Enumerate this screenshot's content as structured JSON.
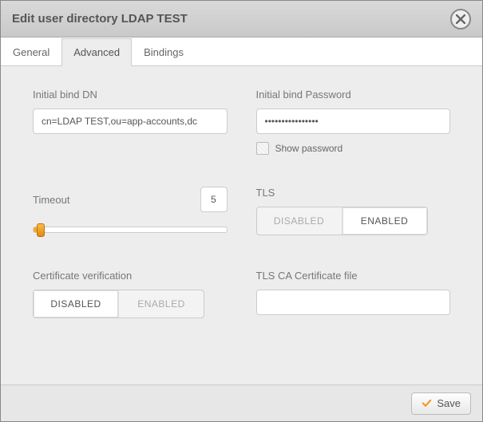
{
  "dialog": {
    "title": "Edit user directory LDAP TEST"
  },
  "tabs": {
    "general": "General",
    "advanced": "Advanced",
    "bindings": "Bindings",
    "active": "advanced"
  },
  "fields": {
    "bind_dn": {
      "label": "Initial bind DN",
      "value": "cn=LDAP TEST,ou=app-accounts,dc"
    },
    "bind_password": {
      "label": "Initial bind Password",
      "value": "••••••••••••••••",
      "show_password_label": "Show password",
      "show_password_checked": false
    },
    "timeout": {
      "label": "Timeout",
      "value": "5",
      "min": 0,
      "max": 300
    },
    "tls": {
      "label": "TLS",
      "disabled_label": "DISABLED",
      "enabled_label": "ENABLED",
      "selected": "enabled"
    },
    "cert_verify": {
      "label": "Certificate verification",
      "disabled_label": "DISABLED",
      "enabled_label": "ENABLED",
      "selected": "disabled"
    },
    "ca_file": {
      "label": "TLS CA Certificate file",
      "value": ""
    }
  },
  "footer": {
    "save_label": "Save"
  }
}
